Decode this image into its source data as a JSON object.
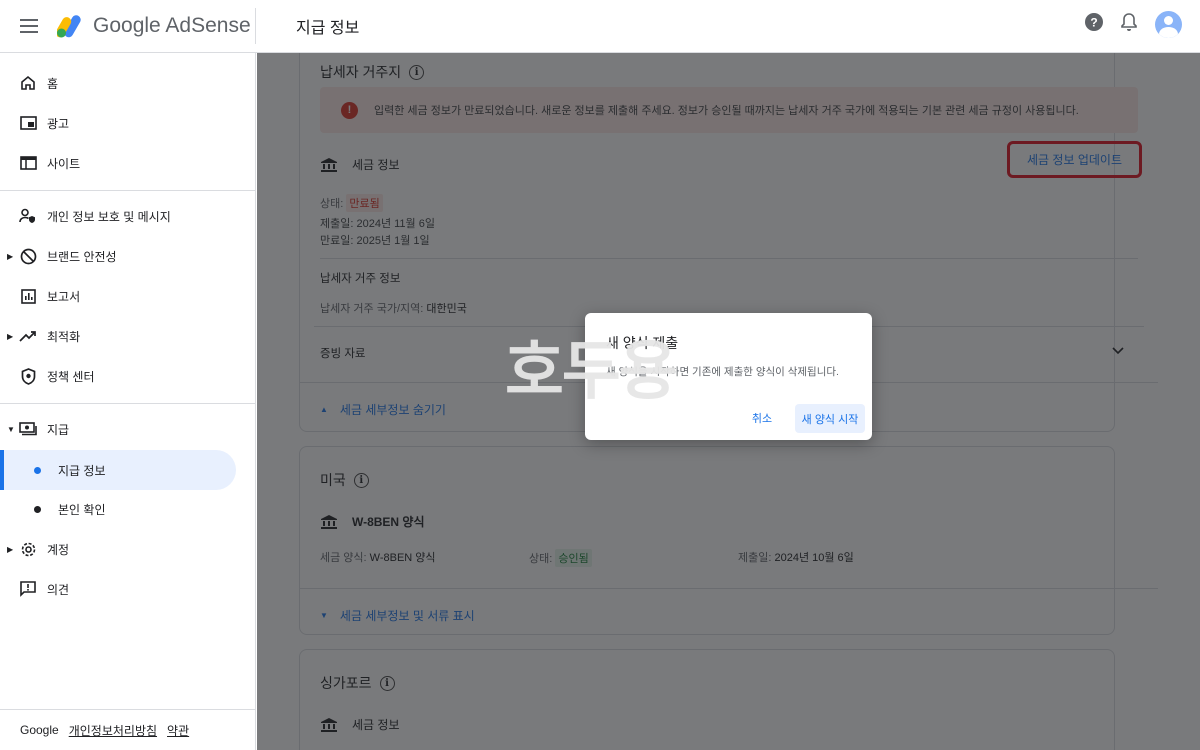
{
  "app": {
    "name": "Google AdSense",
    "page_title": "지급 정보"
  },
  "topbar": {
    "help_icon": "help-icon",
    "bell_icon": "notifications-icon",
    "avatar_icon": "account-avatar"
  },
  "sidebar": {
    "items": [
      {
        "label": "홈",
        "icon": "home-icon"
      },
      {
        "label": "광고",
        "icon": "ads-icon"
      },
      {
        "label": "사이트",
        "icon": "sites-icon"
      },
      {
        "label": "개인 정보 보호 및 메시지",
        "icon": "privacy-icon"
      },
      {
        "label": "브랜드 안전성",
        "icon": "block-icon"
      },
      {
        "label": "보고서",
        "icon": "reports-icon"
      },
      {
        "label": "최적화",
        "icon": "trend-icon"
      },
      {
        "label": "정책 센터",
        "icon": "shield-icon"
      },
      {
        "label": "지급",
        "icon": "payments-icon"
      },
      {
        "label": "지급 정보",
        "icon": "dot"
      },
      {
        "label": "본인 확인",
        "icon": "dot"
      },
      {
        "label": "계정",
        "icon": "gear-icon"
      },
      {
        "label": "의견",
        "icon": "feedback-icon"
      }
    ],
    "footer": {
      "brand": "Google",
      "privacy": "개인정보처리방침",
      "terms": "약관"
    }
  },
  "tax_residence": {
    "title": "납세자 거주지",
    "alert": "입력한 세금 정보가 만료되었습니다. 새로운 정보를 제출해 주세요. 정보가 승인될 때까지는 납세자 거주 국가에 적용되는 기본 관련 세금 규정이 사용됩니다.",
    "tax_info_label": "세금 정보",
    "update_button": "세금 정보 업데이트",
    "status_label": "상태:",
    "status_value": "만료됨",
    "submitted": "제출일: 2024년 11월 6일",
    "expires": "만료일: 2025년 1월 1일",
    "residence_info_title": "납세자 거주 정보",
    "residence_label": "납세자 거주 국가/지역:",
    "residence_value": "대한민국",
    "evidence": "증빙 자료",
    "hide_details": "세금 세부정보 숨기기"
  },
  "us": {
    "title": "미국",
    "form_title": "W-8BEN 양식",
    "form_label": "세금 양식:",
    "form_value": "W-8BEN 양식",
    "status_label": "상태:",
    "status_value": "승인됨",
    "submitted_label": "제출일:",
    "submitted_value": "2024년 10월 6일",
    "show_details": "세금 세부정보 및 서류 표시"
  },
  "singapore": {
    "title": "싱가포르",
    "tax_info_label": "세금 정보"
  },
  "dialog": {
    "title": "새 양식 제출",
    "body": "새 양식을 시작하면 기존에 제출한 양식이 삭제됩니다.",
    "cancel": "취소",
    "start": "새 양식 시작"
  },
  "watermark": "호두용",
  "colors": {
    "accent": "#1a73e8",
    "error": "#d93025",
    "success": "#188038",
    "highlight_box": "#e2101f"
  }
}
